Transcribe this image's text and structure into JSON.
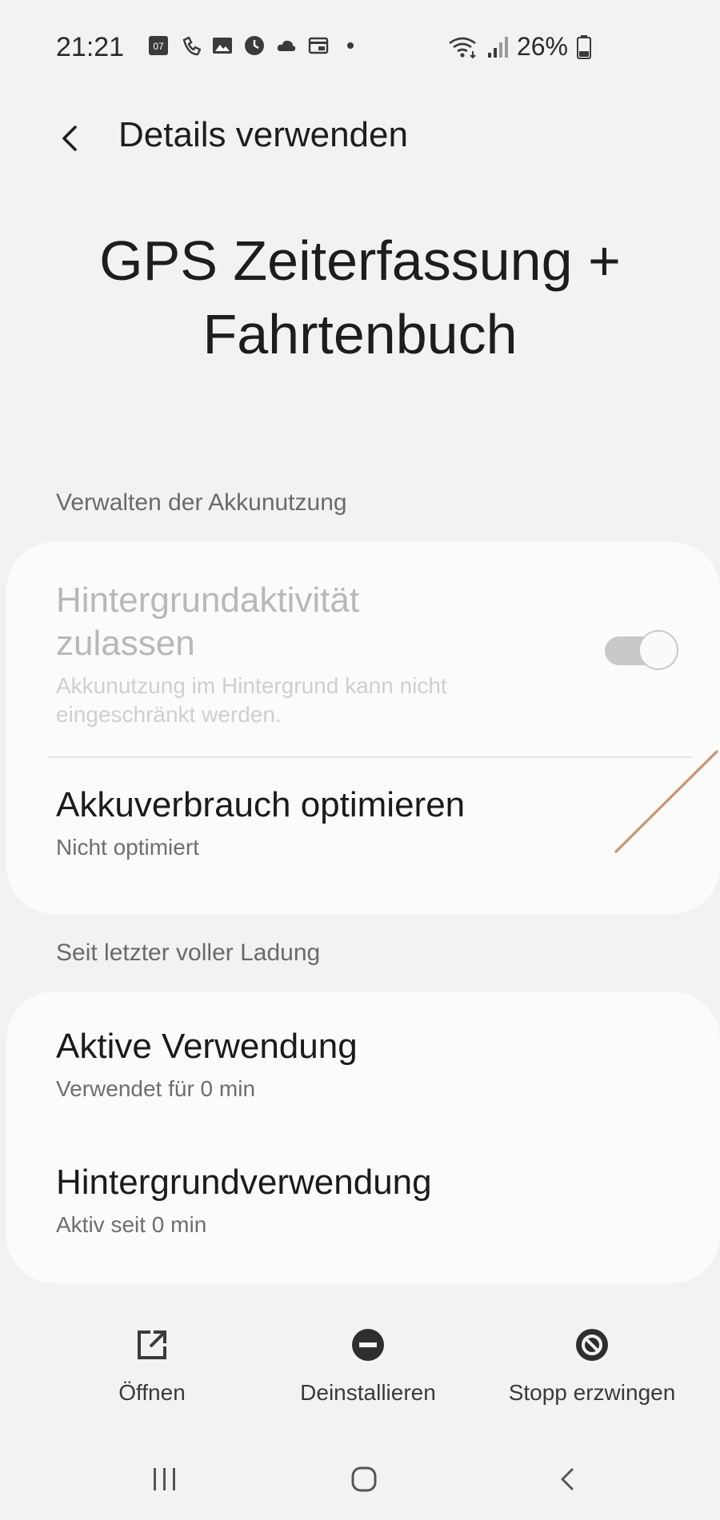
{
  "status_bar": {
    "time": "21:21",
    "notification_badge": "07",
    "battery_percent": "26%",
    "icons": [
      "calendar-badge-icon",
      "call-icon",
      "image-icon",
      "clock-icon",
      "cloud-icon",
      "card-icon",
      "dot-icon",
      "wifi-icon",
      "signal-icon",
      "battery-icon"
    ]
  },
  "header": {
    "title": "Details verwenden",
    "back_icon": "chevron-left-icon"
  },
  "app": {
    "name_line1": "GPS Zeiterfassung +",
    "name_line2": "Fahrtenbuch"
  },
  "battery_section": {
    "label": "Verwalten der Akkunutzung",
    "background_activity": {
      "title_line1": "Hintergrundaktivität",
      "title_line2": "zulassen",
      "subtitle_line1": "Akkunutzung im Hintergrund kann nicht",
      "subtitle_line2": "eingeschränkt werden.",
      "toggle_on": true,
      "enabled": false
    },
    "optimize": {
      "title": "Akkuverbrauch optimieren",
      "subtitle": "Nicht optimiert"
    }
  },
  "usage_section": {
    "label": "Seit letzter voller Ladung",
    "active": {
      "title": "Aktive Verwendung",
      "subtitle": "Verwendet für 0 min"
    },
    "background": {
      "title": "Hintergrundverwendung",
      "subtitle": "Aktiv seit 0 min"
    }
  },
  "actions": {
    "open": {
      "label": "Öffnen",
      "icon": "open-external-icon"
    },
    "uninstall": {
      "label": "Deinstallieren",
      "icon": "minus-circle-icon"
    },
    "force_stop": {
      "label": "Stopp erzwingen",
      "icon": "block-icon"
    }
  },
  "navigation": {
    "recents_icon": "recents-icon",
    "home_icon": "home-icon",
    "back_icon": "nav-back-icon"
  },
  "colors": {
    "background": "#f2f2f2",
    "card": "#fbfbfb",
    "text_primary": "#1b1b1b",
    "text_secondary": "#6e6e6e",
    "text_disabled": "#b8b8b8",
    "toggle_disabled": "#c9c9c9"
  }
}
